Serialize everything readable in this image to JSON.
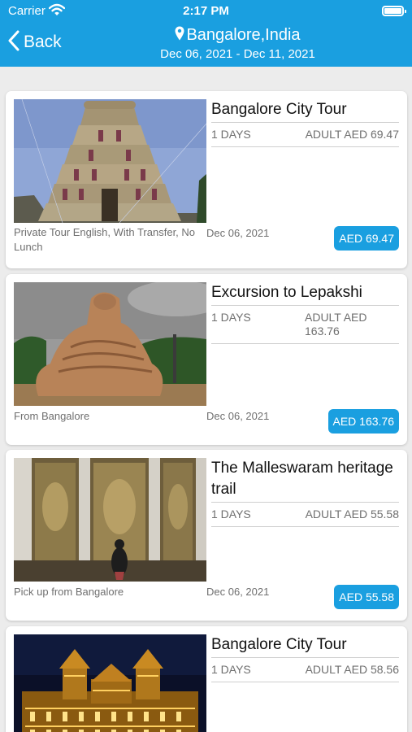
{
  "status_bar": {
    "carrier": "Carrier",
    "time": "2:17 PM"
  },
  "nav": {
    "back_label": "Back",
    "location": "Bangalore,India",
    "dates": "Dec 06, 2021 - Dec 11, 2021"
  },
  "tours": [
    {
      "title": "Bangalore City Tour",
      "days": "1 DAYS",
      "adult_price": "ADULT AED 69.47",
      "description": "Private Tour English, With Transfer, No Lunch",
      "date": "Dec 06, 2021",
      "price_button": "AED 69.47"
    },
    {
      "title": "Excursion to Lepakshi",
      "days": "1 DAYS",
      "adult_price": "ADULT AED 163.76",
      "description": "From Bangalore",
      "date": "Dec 06, 2021",
      "price_button": "AED 163.76"
    },
    {
      "title": "The Malleswaram heritage trail",
      "days": "1 DAYS",
      "adult_price": "ADULT AED 55.58",
      "description": "Pick up from Bangalore",
      "date": "Dec 06, 2021",
      "price_button": "AED 55.58"
    },
    {
      "title": "Bangalore City Tour",
      "days": "1 DAYS",
      "adult_price": "ADULT AED 58.56",
      "description": "",
      "date": "",
      "price_button": ""
    }
  ]
}
